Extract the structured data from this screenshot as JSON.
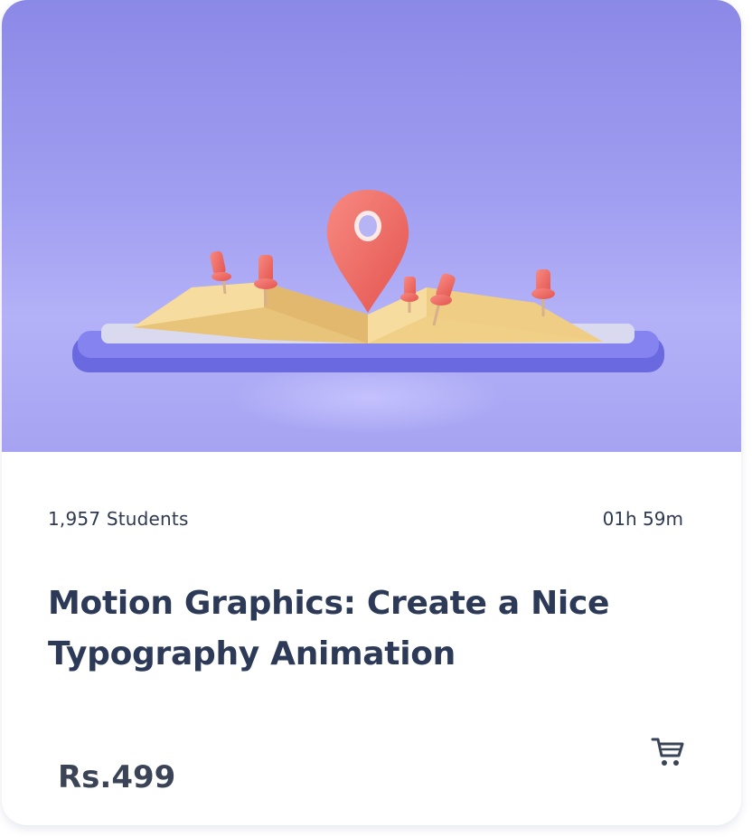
{
  "course": {
    "students": "1,957 Students",
    "duration": "01h 59m",
    "title": "Motion Graphics: Create a Nice Typography Animation",
    "price": "Rs.499"
  },
  "icons": {
    "cart": "shopping-cart-icon",
    "hero": "map-with-location-pins-illustration"
  },
  "colors": {
    "hero_background": "#9c9aef",
    "text_primary": "#2c3a57",
    "pin": "#ee6a64",
    "map": "#f3d68f",
    "phone": "#6f6ee6"
  }
}
